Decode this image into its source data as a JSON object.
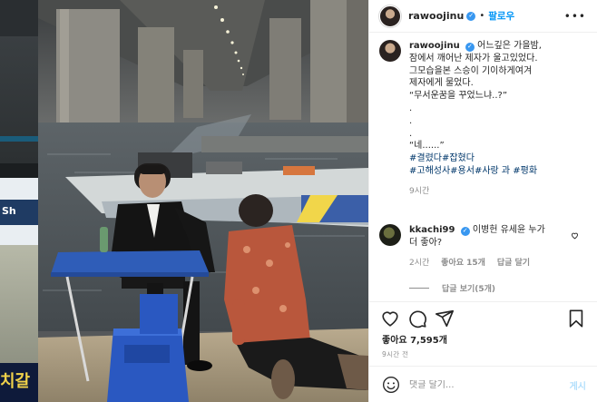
{
  "post": {
    "username": "rawoojinu",
    "follow_label": "팔로우",
    "more_icon": "more-horizontal-icon",
    "caption": {
      "lines": [
        "어느깊은 가을밤,",
        "잠에서 깨어난 제자가 울고있었다.",
        "그모습을본 스승이 기이하게여겨",
        "제자에게 물었다.",
        "“무서운꿈을 꾸었느냐..?”",
        ".",
        ".",
        ".",
        "“네......”"
      ],
      "hashtags_line1": "#결렸다#잡혔다",
      "hashtags_line2": "#고해성사#용서#사랑 과 #평화",
      "time": "9시간"
    },
    "comment": {
      "username": "kkachi99",
      "text_line1": "이병헌 유세윤 누가",
      "text_line2": "더 좋아?",
      "time": "2시간",
      "likes": "좋아요 15개",
      "reply_label": "답글 달기",
      "view_replies": "답글 보기(5개)"
    },
    "likes_label": "좋아요 7,595개",
    "timestamp": "9시간 전",
    "comment_placeholder": "댓글 달기...",
    "post_button": "게시",
    "colors": {
      "link_blue": "#0095f6",
      "hashtag": "#00376b",
      "muted": "#8e8e8e",
      "verified": "#3897f0"
    }
  },
  "backdrop": {
    "partial_text": "치갈"
  }
}
